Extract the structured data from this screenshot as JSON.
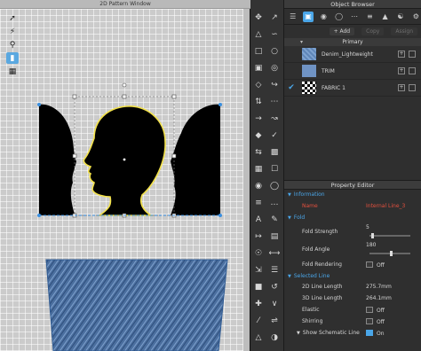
{
  "pattern_window": {
    "title": "2D Pattern Window"
  },
  "object_browser": {
    "title": "Object Browser",
    "add_label": "+ Add",
    "copy_label": "Copy",
    "assign_label": "Assign",
    "group_label": "Primary",
    "fabrics": [
      {
        "name": "Denim_Lightweight",
        "selected": false,
        "swatch": "denim"
      },
      {
        "name": "TRIM",
        "selected": false,
        "swatch": "trim"
      },
      {
        "name": "FABRIC 1",
        "selected": true,
        "swatch": "fabric"
      }
    ]
  },
  "property_editor": {
    "title": "Property Editor",
    "sections": {
      "information": "Information",
      "fold": "Fold",
      "selected_line": "Selected Line"
    },
    "name": {
      "label": "Name",
      "value": "Internal Line_3"
    },
    "fold_strength": {
      "label": "Fold Strength",
      "value": "5",
      "level": 0.05
    },
    "fold_angle": {
      "label": "Fold Angle",
      "value": "180",
      "level": 0.5
    },
    "fold_rendering": {
      "label": "Fold Rendering",
      "value": "Off"
    },
    "line_2d": {
      "label": "2D Line Length",
      "value": "275.7mm"
    },
    "line_3d": {
      "label": "3D Line Length",
      "value": "264.1mm"
    },
    "elastic": {
      "label": "Elastic",
      "value": "Off"
    },
    "shirring": {
      "label": "Shirring",
      "value": "Off"
    },
    "schematic": {
      "label": "Show Schematic Line",
      "value": "On"
    }
  },
  "colors": {
    "accent": "#4aa6e8",
    "selection_outline": "#f2e14a",
    "name_red": "#e4503e"
  }
}
